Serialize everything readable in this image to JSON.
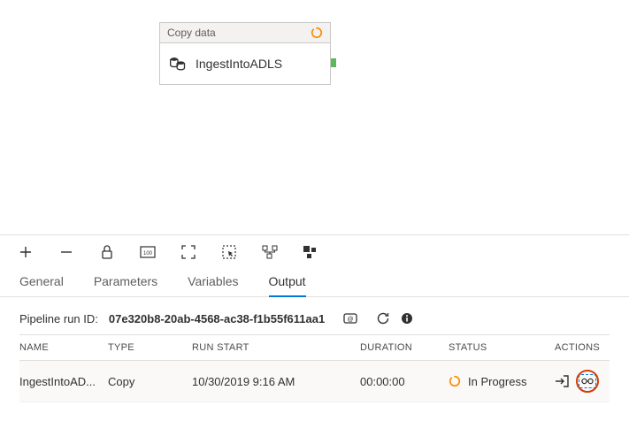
{
  "activity": {
    "type_label": "Copy data",
    "name": "IngestIntoADLS"
  },
  "tabs": {
    "general": "General",
    "parameters": "Parameters",
    "variables": "Variables",
    "output": "Output"
  },
  "active_tab": "output",
  "run": {
    "label": "Pipeline run ID:",
    "id": "07e320b8-20ab-4568-ac38-f1b55f611aa1"
  },
  "columns": {
    "name": "NAME",
    "type": "TYPE",
    "run_start": "RUN START",
    "duration": "DURATION",
    "status": "STATUS",
    "actions": "ACTIONS"
  },
  "rows": [
    {
      "name": "IngestIntoAD...",
      "type": "Copy",
      "run_start": "10/30/2019 9:16 AM",
      "duration": "00:00:00",
      "status": "In Progress"
    }
  ]
}
